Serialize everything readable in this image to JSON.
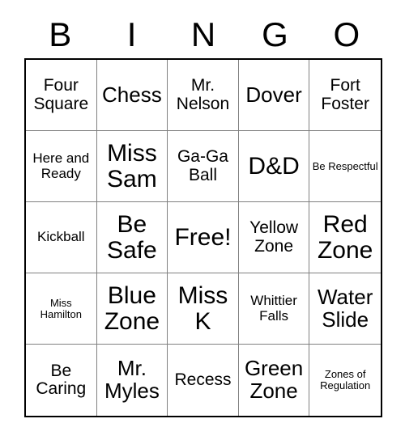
{
  "card": {
    "title": "BINGO",
    "header_letters": [
      "B",
      "I",
      "N",
      "G",
      "O"
    ],
    "columns": 5,
    "rows": 5,
    "free_space_label": "Free!",
    "colors": {
      "background": "#ffffff",
      "text": "#000000",
      "outer_border": "#000000",
      "inner_border": "#808080"
    },
    "cells": [
      {
        "text": "Four Square",
        "size": "md"
      },
      {
        "text": "Chess",
        "size": "lg"
      },
      {
        "text": "Mr. Nelson",
        "size": "md"
      },
      {
        "text": "Dover",
        "size": "lg"
      },
      {
        "text": "Fort Foster",
        "size": "md"
      },
      {
        "text": "Here and Ready",
        "size": "sm"
      },
      {
        "text": "Miss Sam",
        "size": "xl"
      },
      {
        "text": "Ga-Ga Ball",
        "size": "md"
      },
      {
        "text": "D&D",
        "size": "xl"
      },
      {
        "text": "Be Respectful",
        "size": "xs"
      },
      {
        "text": "Kickball",
        "size": "sm"
      },
      {
        "text": "Be Safe",
        "size": "xl"
      },
      {
        "text": "Free!",
        "size": "xl"
      },
      {
        "text": "Yellow Zone",
        "size": "md"
      },
      {
        "text": "Red Zone",
        "size": "xl"
      },
      {
        "text": "Miss Hamilton",
        "size": "xs"
      },
      {
        "text": "Blue Zone",
        "size": "xl"
      },
      {
        "text": "Miss K",
        "size": "xl"
      },
      {
        "text": "Whittier Falls",
        "size": "sm"
      },
      {
        "text": "Water Slide",
        "size": "lg"
      },
      {
        "text": "Be Caring",
        "size": "md"
      },
      {
        "text": "Mr. Myles",
        "size": "lg"
      },
      {
        "text": "Recess",
        "size": "md"
      },
      {
        "text": "Green Zone",
        "size": "lg"
      },
      {
        "text": "Zones of Regulation",
        "size": "xs"
      }
    ]
  }
}
